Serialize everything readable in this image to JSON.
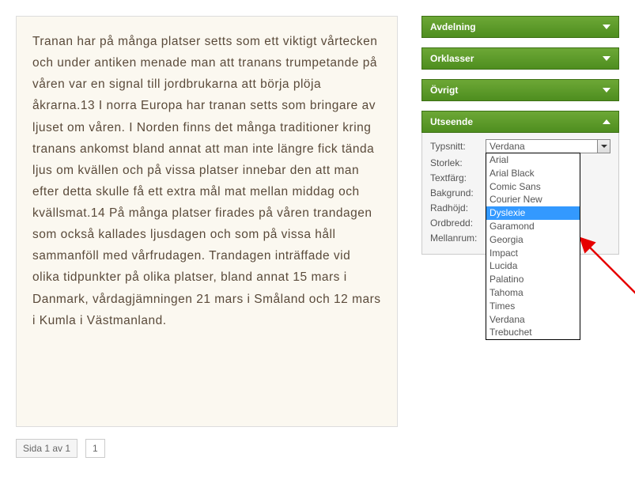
{
  "content": {
    "text": "Tranan har på många platser setts som ett viktigt vårtecken och under antiken menade man att tranans trumpetande på våren var en signal till jordbrukarna att börja plöja åkrarna.13 I norra Europa har tranan setts som bringare av ljuset om våren. I Norden finns det många traditioner kring tranans ankomst bland annat att man inte längre fick tända ljus om kvällen och på vissa platser innebar den att man efter detta skulle få ett extra mål mat mellan middag och kvällsmat.14 På många platser firades på våren trandagen som också kallades ljusdagen och som på vissa håll sammanföll med vårfrudagen. Trandagen inträffade vid olika tidpunkter på olika platser, bland annat 15 mars i Danmark, vårdagjämningen 21 mars i Småland och 12 mars i Kumla i Västmanland."
  },
  "pager": {
    "info": "Sida 1 av 1",
    "current": "1"
  },
  "panels": {
    "avdelning": "Avdelning",
    "orklasser": "Orklasser",
    "ovrigt": "Övrigt",
    "utseende": {
      "title": "Utseende",
      "typsnitt": {
        "label": "Typsnitt:",
        "value": "Verdana"
      },
      "storlek": {
        "label": "Storlek:"
      },
      "textfarg": {
        "label": "Textfärg:"
      },
      "bakgrund": {
        "label": "Bakgrund:"
      },
      "radhojd": {
        "label": "Radhöjd:"
      },
      "ordbredd": {
        "label": "Ordbredd:"
      },
      "mellanrum": {
        "label": "Mellanrum:"
      }
    }
  },
  "dropdown": {
    "selected": "Dyslexie",
    "options": [
      "Arial",
      "Arial Black",
      "Comic Sans",
      "Courier New",
      "Dyslexie",
      "Garamond",
      "Georgia",
      "Impact",
      "Lucida",
      "Palatino",
      "Tahoma",
      "Times",
      "Verdana",
      "Trebuchet"
    ]
  }
}
